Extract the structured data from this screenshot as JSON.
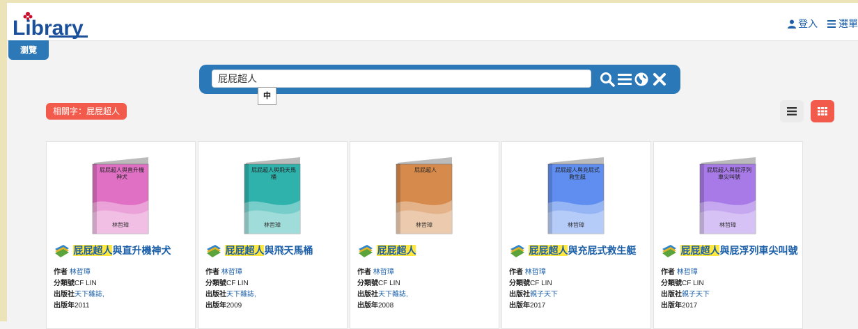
{
  "header": {
    "logo_text": "Library",
    "login": "登入",
    "menu": "選單"
  },
  "nav": {
    "browse_tab": "瀏覽"
  },
  "search": {
    "value": "屁屁超人",
    "ime_indicator": "中",
    "icons": [
      "search-icon",
      "list-icon",
      "globe-icon",
      "close-icon"
    ]
  },
  "keyword_tag": "相關字：屁屁超人",
  "view_toggle": {
    "active": "grid",
    "options": [
      "list-view-icon",
      "grid-view-icon"
    ]
  },
  "labels": {
    "author": "作者",
    "callno": "分類號",
    "publisher": "出版社",
    "year": "出版年"
  },
  "highlight_term": "屁屁超人",
  "books": [
    {
      "cover_title": "屁屁超人與直升機神犬",
      "cover_author": "林哲璋",
      "cover_color": "#e070c4",
      "title_highlight": "屁屁超人",
      "title_rest": "與直升機神犬",
      "author": "林哲璋",
      "callno": "CF LIN",
      "publisher": "天下雜誌,",
      "year": "2011"
    },
    {
      "cover_title": "屁屁超人與飛天馬桶",
      "cover_author": "林哲璋",
      "cover_color": "#2fb2ac",
      "title_highlight": "屁屁超人",
      "title_rest": "與飛天馬桶",
      "author": "林哲璋",
      "callno": "CF LIN",
      "publisher": "天下雜誌,",
      "year": "2009"
    },
    {
      "cover_title": "屁屁超人",
      "cover_author": "林哲璋",
      "cover_color": "#d68a4c",
      "title_highlight": "屁屁超人",
      "title_rest": "",
      "author": "林哲璋",
      "callno": "CF LIN",
      "publisher": "天下雜誌,",
      "year": "2008"
    },
    {
      "cover_title": "屁屁超人與充屁式救生艇",
      "cover_author": "林哲璋",
      "cover_color": "#5f8ef0",
      "title_highlight": "屁屁超人",
      "title_rest": "與充屁式救生艇",
      "author": "林哲璋",
      "callno": "CF LIN",
      "publisher": "親子天下",
      "year": "2017"
    },
    {
      "cover_title": "屁屁超人與屁浮列車尖叫號",
      "cover_author": "林哲璋",
      "cover_color": "#a77ae8",
      "title_highlight": "屁屁超人",
      "title_rest": "與屁浮列車尖叫號",
      "author": "林哲璋",
      "callno": "CF LIN",
      "publisher": "親子天下",
      "year": "2017"
    }
  ]
}
